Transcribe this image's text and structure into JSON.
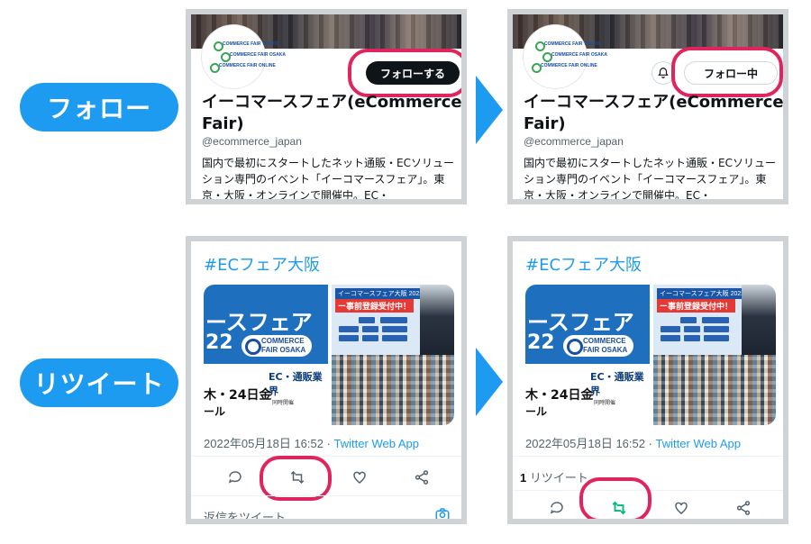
{
  "labels": {
    "follow": "フォロー",
    "retweet": "リツイート"
  },
  "profile": {
    "name": "イーコマースフェア(eCommerce Fair)",
    "handle": "@ecommerce_japan",
    "bio": "国内で最初にスタートしたネット通販・ECソリューション専門のイベント「イーコマースフェア」。東京・大阪・オンラインで開催中。EC・",
    "follow_button": "フォローする",
    "following_button": "フォロー中",
    "logo_lines": [
      "COMMERCE FAIR TOKYO",
      "COMMERCE FAIR OSAKA",
      "COMMERCE FAIR ONLINE"
    ]
  },
  "tweet": {
    "hashtag": "#ECフェア大阪",
    "timestamp": "2022年05月18日 16:52 · ",
    "via": "Twitter Web App",
    "retweet_count": "1",
    "retweet_count_label": "リツイート",
    "reply_placeholder": "返信をツイート",
    "image": {
      "title": "ースフェア",
      "year": "22",
      "badge": "COMMERCE FAIR OSAKA",
      "category": "EC・通販業界",
      "date": "木・24日金",
      "hall": "ール",
      "co": "同時開催",
      "right_title": "イーコマースフェア大阪 2022",
      "right_reg": "ー事前登録受付中！"
    }
  },
  "colors": {
    "accent": "#1d9bf0",
    "highlight_ring": "#e0245e",
    "retweet_active": "#00ba7c"
  }
}
